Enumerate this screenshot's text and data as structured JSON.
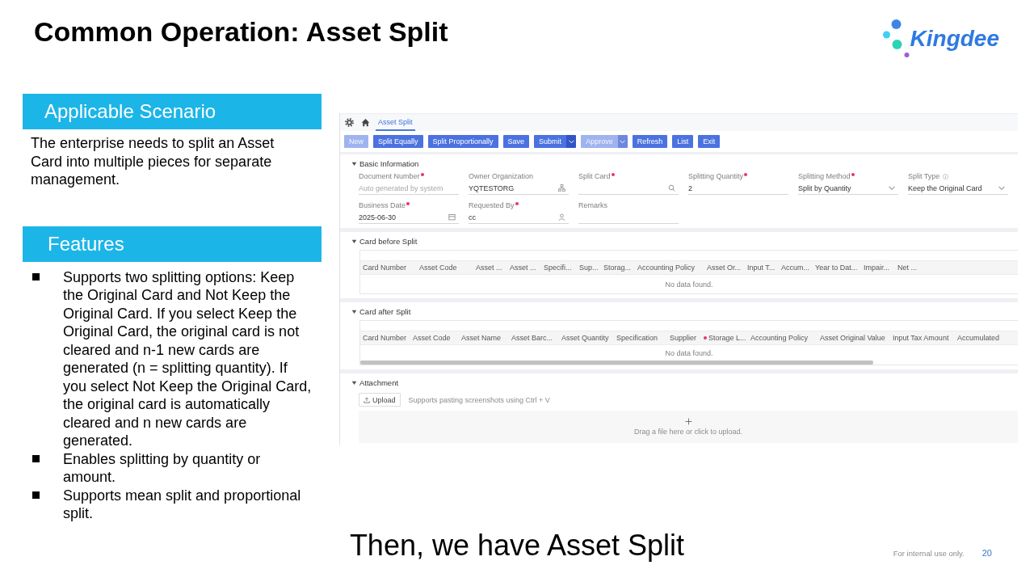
{
  "title": "Common Operation: Asset Split",
  "logo": {
    "text": "Kingdee"
  },
  "scenario": {
    "heading": "Applicable Scenario",
    "text": "The enterprise needs to split an Asset Card into multiple pieces for separate management."
  },
  "features": {
    "heading": "Features",
    "bullets": [
      "Supports two splitting options: Keep the Original Card and Not Keep the Original Card. If you select Keep the Original Card, the original card is not cleared and n-1 new cards are generated (n = splitting quantity). If you select Not Keep the Original Card, the original card is automatically cleared and n new cards are generated.",
      "Enables splitting by quantity or amount.",
      "Supports mean split and proportional split."
    ]
  },
  "app": {
    "tabs": [
      {
        "label": "Asset Split",
        "selected": true
      }
    ],
    "toolbar": [
      {
        "label": "New",
        "disabled": true,
        "dropdown": false
      },
      {
        "label": "Split Equally",
        "disabled": false,
        "dropdown": false
      },
      {
        "label": "Split Proportionally",
        "disabled": false,
        "dropdown": false
      },
      {
        "label": "Save",
        "disabled": false,
        "dropdown": false
      },
      {
        "label": "Submit",
        "disabled": false,
        "dropdown": true
      },
      {
        "label": "Approve",
        "disabled": true,
        "dropdown": true
      },
      {
        "label": "Refresh",
        "disabled": false,
        "dropdown": false
      },
      {
        "label": "List",
        "disabled": false,
        "dropdown": false
      },
      {
        "label": "Exit",
        "disabled": false,
        "dropdown": false
      }
    ],
    "sections": [
      {
        "kind": "form",
        "title": "Basic Information",
        "expanded": true,
        "fields": [
          {
            "label": "Document Number",
            "required": true,
            "info": false,
            "kind": "text",
            "placeholder": "Auto generated by system"
          },
          {
            "label": "Owner Organization",
            "required": false,
            "info": false,
            "kind": "org",
            "value": "YQTESTORG"
          },
          {
            "label": "Split Card",
            "required": true,
            "info": false,
            "kind": "lookup"
          },
          {
            "label": "Splitting Quantity",
            "required": true,
            "info": false,
            "kind": "text",
            "value": "2"
          },
          {
            "label": "Splitting Method",
            "required": true,
            "info": false,
            "kind": "select",
            "value": "Split by Quantity"
          },
          {
            "label": "Split Type",
            "required": false,
            "info": true,
            "kind": "select",
            "value": "Keep the Original Card"
          },
          {
            "label": "Business Date",
            "required": true,
            "info": false,
            "kind": "date",
            "value": "2025-06-30"
          },
          {
            "label": "Requested By",
            "required": true,
            "info": false,
            "kind": "person",
            "value": "cc"
          },
          {
            "label": "Remarks",
            "required": false,
            "info": false,
            "kind": "text"
          }
        ]
      },
      {
        "kind": "table",
        "title": "Card before Split",
        "expanded": true,
        "scrollbar": false,
        "columns": [
          {
            "label": "Card Number",
            "required": false
          },
          {
            "label": "Asset Code",
            "required": false
          },
          {
            "label": "Asset ...",
            "required": false
          },
          {
            "label": "Asset ...",
            "required": false
          },
          {
            "label": "Specifi...",
            "required": false
          },
          {
            "label": "Sup...",
            "required": false
          },
          {
            "label": "Storag...",
            "required": false
          },
          {
            "label": "Accounting Policy",
            "required": false
          },
          {
            "label": "Asset Or...",
            "required": false
          },
          {
            "label": "Input T...",
            "required": false
          },
          {
            "label": "Accum...",
            "required": false
          },
          {
            "label": "Year to Dat...",
            "required": false
          },
          {
            "label": "Impair...",
            "required": false
          },
          {
            "label": "Net ...",
            "required": false
          }
        ],
        "empty_text": "No data found."
      },
      {
        "kind": "table",
        "title": "Card after Split",
        "expanded": true,
        "scrollbar": true,
        "columns": [
          {
            "label": "Card Number",
            "required": false
          },
          {
            "label": "Asset Code",
            "required": false
          },
          {
            "label": "Asset Name",
            "required": false
          },
          {
            "label": "Asset Barc...",
            "required": false
          },
          {
            "label": "Asset Quantity",
            "required": false
          },
          {
            "label": "Specification",
            "required": false
          },
          {
            "label": "Supplier",
            "required": false
          },
          {
            "label": "Storage L...",
            "required": true
          },
          {
            "label": "Accounting Policy",
            "required": false
          },
          {
            "label": "Asset Original Value",
            "required": false
          },
          {
            "label": "Input Tax Amount",
            "required": false
          },
          {
            "label": "Accumulated",
            "required": false
          }
        ],
        "empty_text": "No data found."
      },
      {
        "kind": "attachment",
        "title": "Attachment",
        "expanded": true,
        "upload_label": "Upload",
        "hint": "Supports pasting screenshots using Ctrl + V",
        "drop_text": "Drag a file here or click to upload."
      }
    ]
  },
  "caption": "Then, we have Asset Split",
  "footer": {
    "note": "For internal use only.",
    "page_number": "20"
  }
}
